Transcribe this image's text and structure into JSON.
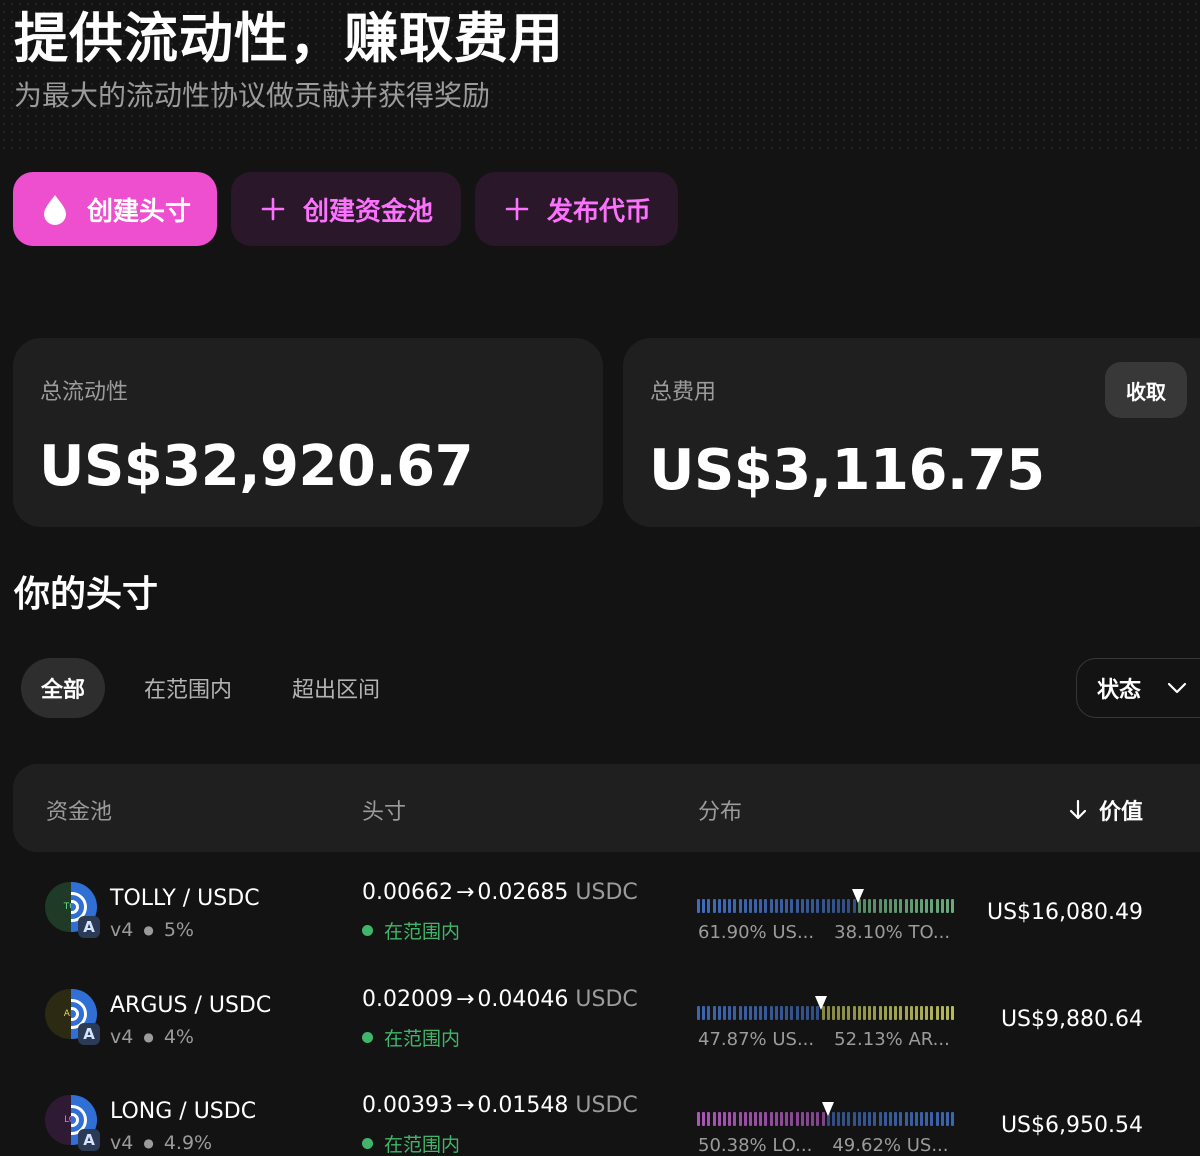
{
  "header": {
    "title": "提供流动性，赚取费用",
    "subtitle": "为最大的流动性协议做贡献并获得奖励"
  },
  "actions": {
    "create_position": "创建头寸",
    "create_pool": "创建资金池",
    "launch_token": "发布代币"
  },
  "stats": {
    "total_liquidity_label": "总流动性",
    "total_liquidity_value": "US$32,920.67",
    "total_fees_label": "总费用",
    "total_fees_value": "US$3,116.75",
    "collect_label": "收取"
  },
  "positions": {
    "title": "你的头寸",
    "filters": [
      "全部",
      "在范围内",
      "超出区间"
    ],
    "active_filter": "全部",
    "status_dropdown": "状态",
    "columns": {
      "pool": "资金池",
      "position": "头寸",
      "distribution": "分布",
      "value": "价值"
    },
    "rows": [
      {
        "pair": "TOLLY / USDC",
        "token_abbr": "TO",
        "version": "v4",
        "fee": "5%",
        "range_low": "0.00662",
        "range_high": "0.02685",
        "quote": "USDC",
        "status": "在范围内",
        "share_left": "61.90% US...",
        "share_right": "38.10% TO...",
        "value": "US$16,080.49",
        "left_fraction": 0.619,
        "left_color": "#4a7fe0",
        "right_color": "#8ee8a8",
        "token_bg": "#1f3a26",
        "token_fg": "#6fdc8c"
      },
      {
        "pair": "ARGUS / USDC",
        "token_abbr": "AR",
        "version": "v4",
        "fee": "4%",
        "range_low": "0.02009",
        "range_high": "0.04046",
        "quote": "USDC",
        "status": "在范围内",
        "share_left": "47.87% US...",
        "share_right": "52.13% AR...",
        "value": "US$9,880.64",
        "left_fraction": 0.4787,
        "left_color": "#4a7fe0",
        "right_color": "#e4e86a",
        "token_bg": "#2c2a12",
        "token_fg": "#e8d75a"
      },
      {
        "pair": "LONG / USDC",
        "token_abbr": "LO",
        "version": "v4",
        "fee": "4.9%",
        "range_low": "0.00393",
        "range_high": "0.01548",
        "quote": "USDC",
        "status": "在范围内",
        "share_left": "50.38% LO...",
        "share_right": "49.62% US...",
        "value": "US$6,950.54",
        "left_fraction": 0.5038,
        "left_color": "#d66ae8",
        "right_color": "#4a7fe0",
        "token_bg": "#2f1a33",
        "token_fg": "#d878f0"
      }
    ]
  },
  "colors": {
    "accent": "#fc72ff",
    "primary_button": "#ee4fcf",
    "in_range": "#40b66b"
  },
  "icons": {
    "create_position": "droplet-icon",
    "create_pool": "plus-icon",
    "launch_token": "plus-icon",
    "status": "chevron-down-icon",
    "sort": "arrow-down-icon"
  }
}
